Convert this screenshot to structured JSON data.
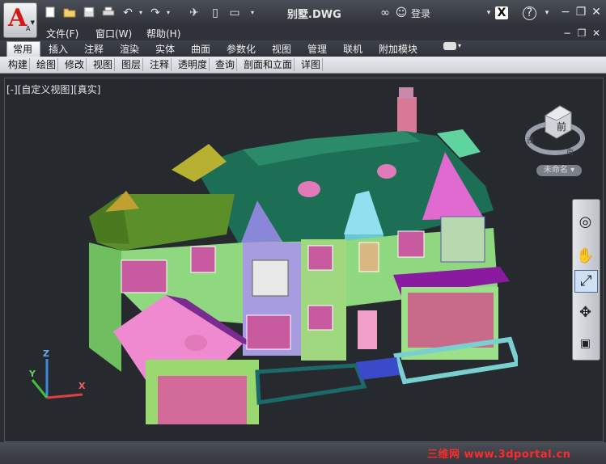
{
  "app": {
    "logo_letter": "A",
    "logo_sub": "A",
    "doc_title": "别墅.DWG"
  },
  "quick_access": {
    "icons": [
      "new-icon",
      "open-icon",
      "save-icon",
      "print-icon",
      "undo-icon",
      "redo-icon"
    ]
  },
  "toolbar_right": {
    "login_label": "登录"
  },
  "menubar": {
    "items": [
      "文件(F)",
      "窗口(W)",
      "帮助(H)"
    ]
  },
  "ribbon": {
    "tabs": [
      "常用",
      "插入",
      "注释",
      "渲染",
      "实体",
      "曲面",
      "参数化",
      "视图",
      "管理",
      "联机",
      "附加模块"
    ],
    "active_tab": "常用",
    "panels": [
      "构建",
      "绘图",
      "修改",
      "视图",
      "图层",
      "注释",
      "透明度",
      "查询",
      "剖面和立面",
      "详图"
    ]
  },
  "viewport": {
    "label": "[-][自定义视图][真实]",
    "viewcube_face": "前",
    "viewcube_unnamed": "未命名",
    "compass": {
      "west": "西",
      "south": "南"
    },
    "ucs": {
      "x": "X",
      "y": "Y",
      "z": "Z"
    }
  },
  "watermark": "三维网 www.3dportal.cn",
  "colors": {
    "accent": "#d11a1a",
    "viewport_bg": "#262a2f"
  }
}
